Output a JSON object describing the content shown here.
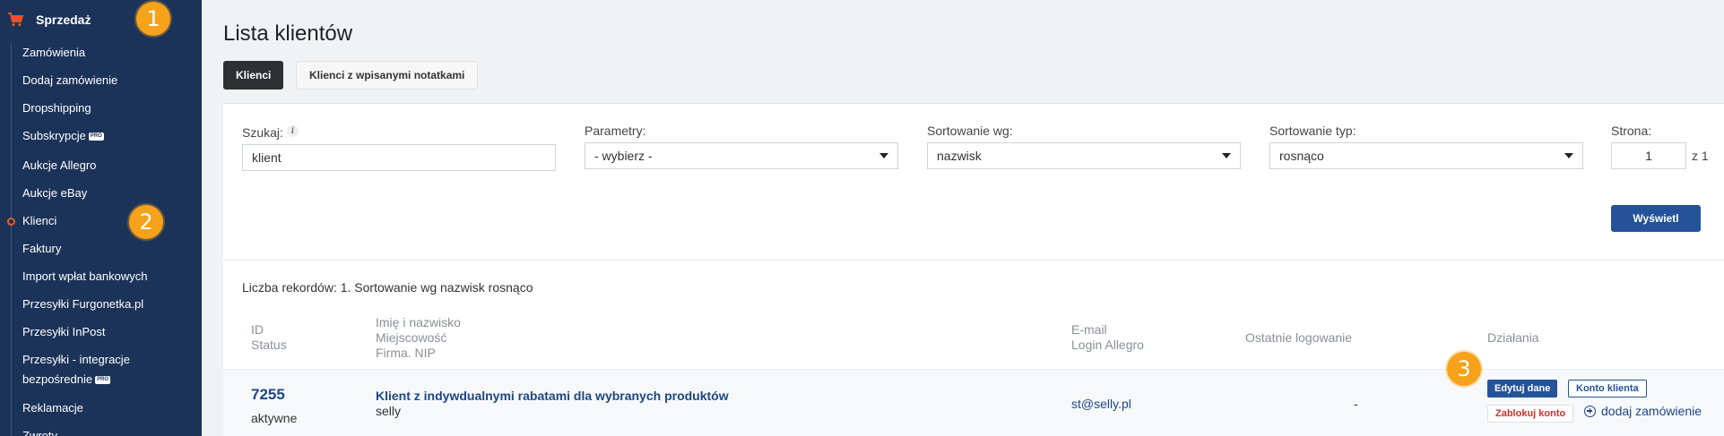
{
  "sidebar": {
    "section_title": "Sprzedaż",
    "items": [
      {
        "label": "Zamówienia"
      },
      {
        "label": "Dodaj zamówienie"
      },
      {
        "label": "Dropshipping"
      },
      {
        "label": "Subskrypcje",
        "badge": "PRO"
      },
      {
        "label": "Aukcje Allegro"
      },
      {
        "label": "Aukcje eBay"
      },
      {
        "label": "Klienci",
        "active": true
      },
      {
        "label": "Faktury"
      },
      {
        "label": "Import wpłat bankowych"
      },
      {
        "label": "Przesyłki Furgonetka.pl"
      },
      {
        "label": "Przesyłki InPost"
      },
      {
        "label": "Przesyłki - integracje",
        "label2": "bezpośrednie",
        "badge": "PRO"
      },
      {
        "label": "Reklamacje"
      },
      {
        "label": "Zwroty"
      }
    ]
  },
  "badges": [
    "1",
    "2",
    "3"
  ],
  "colors": {
    "sidebar": "#1c3359",
    "accent": "#24539a",
    "badge": "#f7a21b",
    "danger": "#d0312d"
  },
  "page": {
    "title": "Lista klientów",
    "tabs": [
      {
        "label": "Klienci",
        "active": true
      },
      {
        "label": "Klienci z wpisanymi notatkami",
        "active": false
      }
    ]
  },
  "filters": {
    "search": {
      "label": "Szukaj:",
      "value": "klient"
    },
    "params": {
      "label": "Parametry:",
      "value": "- wybierz -"
    },
    "sort_by": {
      "label": "Sortowanie wg:",
      "value": "nazwisk"
    },
    "sort_type": {
      "label": "Sortowanie typ:",
      "value": "rosnąco"
    },
    "page": {
      "label": "Strona:",
      "value": "1",
      "of": "z 1"
    },
    "submit": "Wyświetl"
  },
  "table": {
    "summary": "Liczba rekordów: 1. Sortowanie wg nazwisk rosnąco",
    "headers": {
      "id": [
        "ID",
        "Status"
      ],
      "name": [
        "Imię i nazwisko",
        "Miejscowość",
        "Firma. NIP"
      ],
      "email": [
        "E-mail",
        "Login Allegro"
      ],
      "last_login": "Ostatnie logowanie",
      "actions": "Działania"
    },
    "rows": [
      {
        "id": "7255",
        "status": "aktywne",
        "name": "Klient z indywdualnymi rabatami dla wybranych produktów",
        "city": "selly",
        "email": "st@selly.pl",
        "last_login": "-",
        "actions": {
          "edit": "Edytuj dane",
          "account": "Konto klienta",
          "block": "Zablokuj konto",
          "add_order": "dodaj zamówienie"
        }
      }
    ]
  }
}
